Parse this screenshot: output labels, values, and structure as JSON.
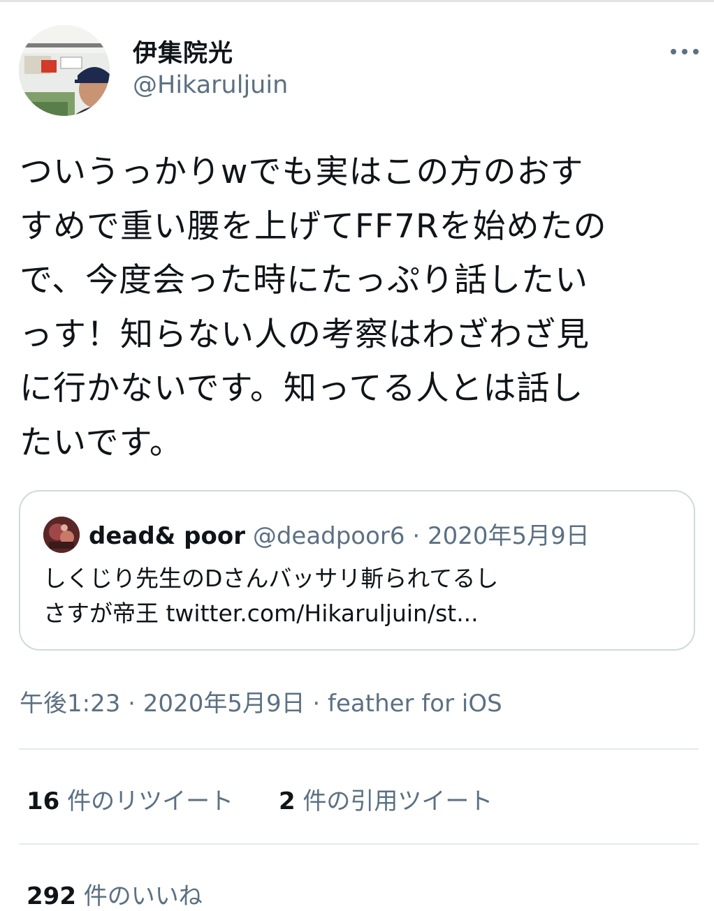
{
  "author": {
    "display_name": "伊集院光",
    "handle": "@Hikaruljuin"
  },
  "menu": {
    "icon": "more-horizontal-icon"
  },
  "tweet": {
    "lines": [
      "ついうっかりwでも実はこの方のおす",
      "すめで重い腰を上げてFF7Rを始めたの",
      "で、今度会った時にたっぷり話したい",
      "っす！知らない人の考察はわざわざ見",
      "に行かないです。知ってる人とは話し",
      "たいです。"
    ]
  },
  "quote": {
    "name": "dead& poor",
    "handle": "@deadpoor6",
    "separator": "·",
    "date": "2020年5月9日",
    "lines": [
      "しくじり先生のDさんバッサリ斬られてるし",
      "さすが帝王 twitter.com/Hikaruljuin/st..."
    ]
  },
  "meta": {
    "time": "午後1:23",
    "sep1": "·",
    "date": "2020年5月9日",
    "sep2": "·",
    "source": "feather for iOS"
  },
  "stats": {
    "retweets_count": "16",
    "retweets_label": "件のリツイート",
    "quotes_count": "2",
    "quotes_label": "件の引用ツイート",
    "likes_count": "292",
    "likes_label": "件のいいね"
  },
  "colors": {
    "text": "#0f1419",
    "secondary": "#5b7083",
    "border": "#cfd9de"
  }
}
